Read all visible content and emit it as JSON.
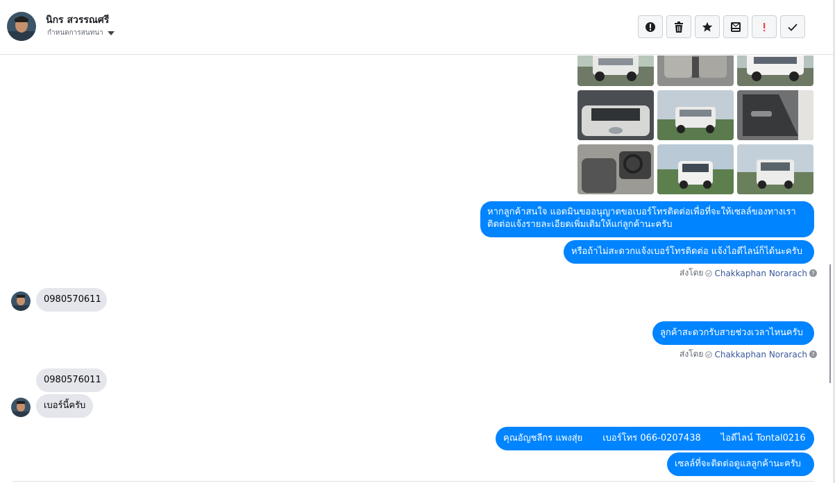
{
  "header": {
    "name": "นิกร สวรรณศรี",
    "assign_label": "กำหนดการสนทนา",
    "toolbar": [
      {
        "icon": "exclamation-circle-icon"
      },
      {
        "icon": "trash-icon"
      },
      {
        "icon": "star-icon"
      },
      {
        "icon": "inbox-icon"
      },
      {
        "icon": "important-icon"
      },
      {
        "icon": "checkmark-icon"
      }
    ]
  },
  "messages": {
    "m1": "หากลูกค้าสนใจ แอดมินขออนุญาตขอเบอร์โทรติดต่อเพื่อที่จะให้เซลล์ของทางเรา",
    "m1b": "ติดต่อแจ้งรายละเอียดเพิ่มเติมให้แก่ลูกค้านะครับ",
    "m2": "หรือถ้าไม่สะดวกแจ้งเบอร์โทรติดต่อ แจ้งไอดีไลน์ก็ได้นะครับ",
    "sent1_prefix": "ส่งโดย",
    "sent1_name": "Chakkaphan Norarach",
    "m3": "0980570611",
    "m4": "ลูกค้าสะดวกรับสายช่วงเวลาไหนครับ",
    "sent2_prefix": "ส่งโดย",
    "sent2_name": "Chakkaphan Norarach",
    "m5": "0980576011",
    "m6": "เบอร์นี้ครับ",
    "m7": "คุณอัญชลีกร แพงสุ่ย       เบอร์โทร 066-0207438       ไอดีไลน์ Tontal0216",
    "m8": "เซลล์ที่จะติดต่อดูแลลูกค้านะครับ"
  },
  "colors": {
    "outgoing": "#0084ff",
    "incoming": "#e4e6eb"
  }
}
